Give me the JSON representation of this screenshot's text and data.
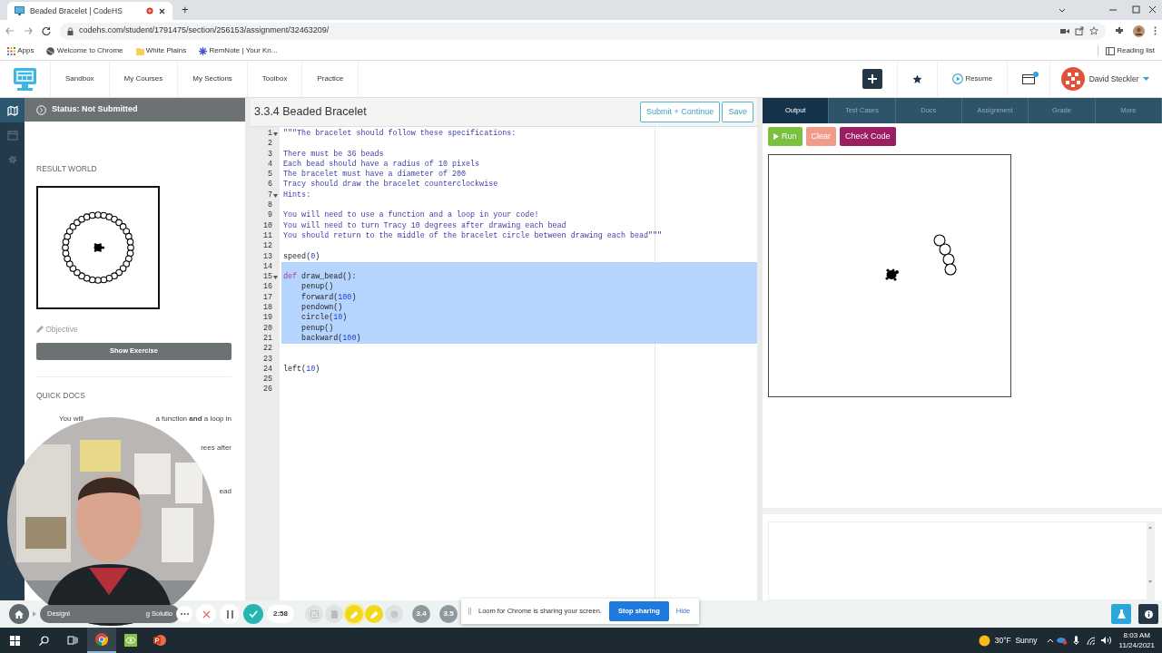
{
  "browser": {
    "tab": {
      "title": "Beaded Bracelet | CodeHS",
      "recording": true
    },
    "new_tab": "+",
    "url": "codehs.com/student/1791475/section/256153/assignment/32463209/",
    "bookmarks": [
      {
        "label": "Apps",
        "kind": "apps"
      },
      {
        "label": "Welcome to Chrome",
        "kind": "globe"
      },
      {
        "label": "White Plains",
        "kind": "folder"
      },
      {
        "label": "RemNote | Your Kn...",
        "kind": "remnote"
      }
    ],
    "reading_list": "Reading list"
  },
  "navbar": {
    "links": [
      "Sandbox",
      "My Courses",
      "My Sections",
      "Toolbox",
      "Practice"
    ],
    "resume": "Resume",
    "notification": true,
    "user": "David Steckler"
  },
  "rail": [
    {
      "kind": "map",
      "selected": true
    },
    {
      "kind": "calendar",
      "selected": false
    },
    {
      "kind": "settings",
      "selected": false
    }
  ],
  "left_panel": {
    "status": "Status: Not Submitted",
    "result_world": "RESULT WORLD",
    "objective": "Objective",
    "show_exercise": "Show Exercise",
    "quick_docs": "QUICK DOCS",
    "items": [
      {
        "parts": [
          "You will",
          "a function **and** a loop in"
        ]
      },
      {
        "parts": [
          "rees after"
        ]
      },
      {
        "parts": [
          "ead"
        ]
      }
    ]
  },
  "editor": {
    "title": "3.3.4 Beaded Bracelet",
    "buttons": [
      "Submit + Continue",
      "Save"
    ],
    "lines": [
      {
        "number": "1",
        "foldable": true,
        "selected": false,
        "tokens": [
          {
            "kind": "string",
            "text": "\"\"\"The bracelet should follow these specifications:"
          }
        ]
      },
      {
        "number": "2",
        "foldable": false,
        "selected": false
      },
      {
        "number": "3",
        "foldable": false,
        "selected": false,
        "tokens": [
          {
            "kind": "string",
            "text": "There must be 36 beads"
          }
        ]
      },
      {
        "number": "4",
        "foldable": false,
        "selected": false,
        "tokens": [
          {
            "kind": "string",
            "text": "Each bead should have a radius of 10 pixels"
          }
        ]
      },
      {
        "number": "5",
        "foldable": false,
        "selected": false,
        "tokens": [
          {
            "kind": "string",
            "text": "The bracelet must have a diameter of 200"
          }
        ]
      },
      {
        "number": "6",
        "foldable": false,
        "selected": false,
        "tokens": [
          {
            "kind": "string",
            "text": "Tracy should draw the bracelet counterclockwise"
          }
        ]
      },
      {
        "number": "7",
        "foldable": true,
        "selected": false,
        "tokens": [
          {
            "kind": "string",
            "text": "Hints:"
          }
        ]
      },
      {
        "number": "8",
        "foldable": false,
        "selected": false
      },
      {
        "number": "9",
        "foldable": false,
        "selected": false,
        "tokens": [
          {
            "kind": "string",
            "text": "You will need to use a function and a loop in your code!"
          }
        ]
      },
      {
        "number": "10",
        "foldable": false,
        "selected": false,
        "tokens": [
          {
            "kind": "string",
            "text": "You will need to turn Tracy 10 degrees after drawing each bead"
          }
        ]
      },
      {
        "number": "11",
        "foldable": false,
        "selected": false,
        "tokens": [
          {
            "kind": "string",
            "text": "You should return to the middle of the bracelet circle between drawing each bead\"\"\""
          }
        ]
      },
      {
        "number": "12",
        "foldable": false,
        "selected": false
      },
      {
        "number": "13",
        "foldable": false,
        "selected": false,
        "tokens": [
          {
            "kind": "plain",
            "text": "speed("
          },
          {
            "kind": "number",
            "text": "0"
          },
          {
            "kind": "plain",
            "text": ")"
          }
        ]
      },
      {
        "number": "14",
        "foldable": false,
        "selected": true
      },
      {
        "number": "15",
        "foldable": true,
        "selected": true,
        "tokens": [
          {
            "kind": "keyword",
            "text": "def"
          },
          {
            "kind": "plain",
            "text": " draw_bead():"
          }
        ]
      },
      {
        "number": "16",
        "foldable": false,
        "selected": true,
        "tokens": [
          {
            "kind": "plain",
            "text": "    penup()"
          }
        ]
      },
      {
        "number": "17",
        "foldable": false,
        "selected": true,
        "tokens": [
          {
            "kind": "plain",
            "text": "    forward("
          },
          {
            "kind": "number",
            "text": "100"
          },
          {
            "kind": "plain",
            "text": ")"
          }
        ]
      },
      {
        "number": "18",
        "foldable": false,
        "selected": true,
        "tokens": [
          {
            "kind": "plain",
            "text": "    pendown()"
          }
        ]
      },
      {
        "number": "19",
        "foldable": false,
        "selected": true,
        "tokens": [
          {
            "kind": "plain",
            "text": "    circle("
          },
          {
            "kind": "number",
            "text": "10"
          },
          {
            "kind": "plain",
            "text": ")"
          }
        ]
      },
      {
        "number": "20",
        "foldable": false,
        "selected": true,
        "tokens": [
          {
            "kind": "plain",
            "text": "    penup()"
          }
        ]
      },
      {
        "number": "21",
        "foldable": false,
        "selected": true,
        "tokens": [
          {
            "kind": "plain",
            "text": "    backward("
          },
          {
            "kind": "number",
            "text": "100"
          },
          {
            "kind": "plain",
            "text": ")"
          }
        ]
      },
      {
        "number": "22",
        "foldable": false,
        "selected": false
      },
      {
        "number": "23",
        "foldable": false,
        "selected": false
      },
      {
        "number": "24",
        "foldable": false,
        "selected": false,
        "tokens": [
          {
            "kind": "plain",
            "text": "left("
          },
          {
            "kind": "number",
            "text": "10"
          },
          {
            "kind": "plain",
            "text": ")"
          }
        ]
      },
      {
        "number": "25",
        "foldable": false,
        "selected": false
      },
      {
        "number": "26",
        "foldable": false,
        "selected": false
      }
    ]
  },
  "output_panel": {
    "tabs": [
      {
        "label": "Output",
        "selected": true
      },
      {
        "label": "Test Cases",
        "selected": false
      },
      {
        "label": "Docs",
        "selected": false
      },
      {
        "label": "Assignment",
        "selected": false
      },
      {
        "label": "Grade",
        "selected": false
      },
      {
        "label": "More",
        "selected": false
      }
    ],
    "buttons": [
      {
        "label": "Run",
        "kind": "run"
      },
      {
        "label": "Clear",
        "kind": "clear"
      },
      {
        "label": "Check Code",
        "kind": "check"
      }
    ]
  },
  "bottom_bar": {
    "breadcrumb": [
      "Designi",
      "g Solutio"
    ],
    "timer": "2:58",
    "lessons": [
      {
        "kind": "check"
      },
      {
        "kind": "doc"
      },
      {
        "kind": "pencil",
        "selected": true
      },
      {
        "kind": "pencil",
        "selected": false
      },
      {
        "kind": "blank"
      },
      {
        "kind": "number",
        "label": "3.4"
      },
      {
        "kind": "number",
        "label": "3.5"
      }
    ]
  },
  "loom_notice": {
    "message": "Loom for Chrome is sharing your screen.",
    "stop": "Stop sharing",
    "hide": "Hide"
  },
  "taskbar": {
    "apps": [
      {
        "kind": "chrome",
        "selected": true
      },
      {
        "kind": "app",
        "selected": false
      },
      {
        "kind": "powerpoint",
        "selected": false
      }
    ],
    "weather": "30°F  Sunny",
    "time": "8:03 AM",
    "date": "11/24/2021"
  }
}
